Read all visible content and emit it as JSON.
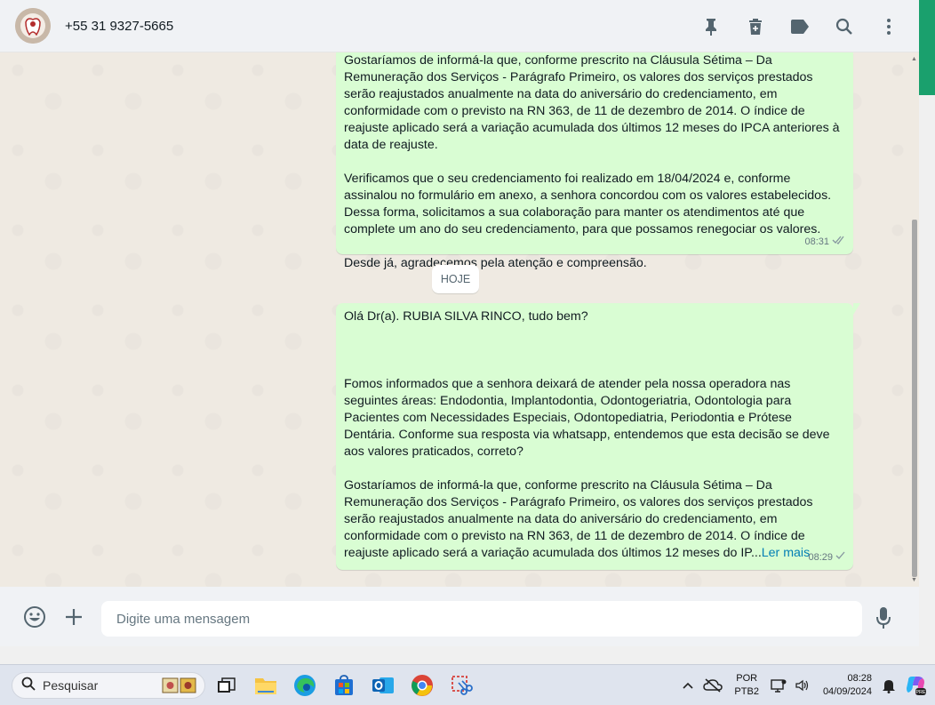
{
  "header": {
    "contact_name": "+55 31 9327-5665",
    "icons": [
      "pin-icon",
      "delete-icon",
      "label-icon",
      "search-icon",
      "menu-icon"
    ]
  },
  "chat": {
    "messages": [
      {
        "paragraphs": [
          "Gostaríamos de informá-la que, conforme prescrito na Cláusula Sétima – Da Remuneração dos Serviços - Parágrafo Primeiro, os valores dos serviços prestados serão reajustados anualmente na data do aniversário do credenciamento, em conformidade com o previsto na RN 363, de 11 de dezembro de 2014. O índice de reajuste aplicado será a variação acumulada dos últimos 12 meses do IPCA anteriores à data de reajuste.",
          "Verificamos que o seu credenciamento foi realizado em 18/04/2024 e, conforme assinalou no formulário em anexo, a senhora concordou com os valores estabelecidos. Dessa forma, solicitamos a sua colaboração para manter os atendimentos até que complete um ano do seu credenciamento, para que possamos renegociar os valores.",
          "Desde já, agradecemos pela atenção e compreensão."
        ],
        "time": "08:31",
        "status": "double-check-icon"
      },
      {
        "paragraphs": [
          "Olá Dr(a). RUBIA SILVA RINCO, tudo bem?",
          "Fomos informados que a senhora deixará de atender pela nossa operadora nas seguintes áreas: Endodontia, Implantodontia, Odontogeriatria, Odontologia para Pacientes com Necessidades Especiais, Odontopediatria, Periodontia e Prótese Dentária. Conforme sua resposta via whatsapp, entendemos que esta decisão se deve aos valores praticados, correto?",
          "Gostaríamos de informá-la que, conforme prescrito na Cláusula Sétima – Da Remuneração dos Serviços - Parágrafo Primeiro, os valores dos serviços prestados serão reajustados anualmente na data do aniversário do credenciamento, em conformidade com o previsto na RN 363, de 11 de dezembro de 2014. O índice de reajuste aplicado será a variação acumulada dos últimos 12 meses do IP..."
        ],
        "read_more": "Ler mais",
        "time": "08:29",
        "status": "single-check-icon"
      }
    ],
    "day_divider": "HOJE"
  },
  "composer": {
    "placeholder": "Digite uma mensagem"
  },
  "taskbar": {
    "search_label": "Pesquisar",
    "lang_line1": "POR",
    "lang_line2": "PTB2",
    "time": "08:28",
    "date": "04/09/2024"
  },
  "colors": {
    "outgoing_bubble": "#d9fdd3",
    "chat_bg": "#efeae2",
    "header_bg": "#f0f2f5",
    "link": "#027eb5",
    "accent_green": "#1aa06d"
  }
}
